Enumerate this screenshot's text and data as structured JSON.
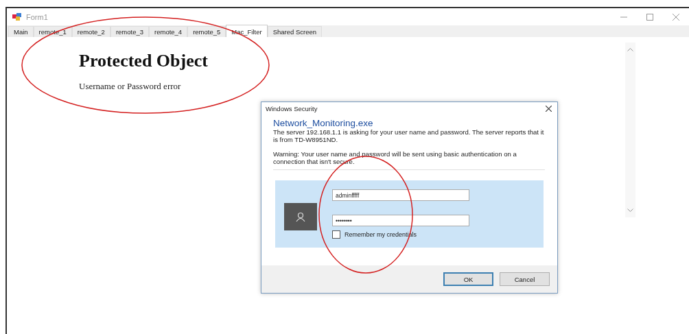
{
  "window": {
    "title": "Form1"
  },
  "tabs": [
    {
      "label": "Main",
      "selected": false
    },
    {
      "label": "remote_1",
      "selected": false
    },
    {
      "label": "remote_2",
      "selected": false
    },
    {
      "label": "remote_3",
      "selected": false
    },
    {
      "label": "remote_4",
      "selected": false
    },
    {
      "label": "remote_5",
      "selected": false
    },
    {
      "label": "Mac_Filter",
      "selected": true
    },
    {
      "label": "Shared Screen",
      "selected": false
    }
  ],
  "page": {
    "heading": "Protected Object",
    "message": "Username or Password error"
  },
  "dialog": {
    "title": "Windows Security",
    "app_name": "Network_Monitoring.exe",
    "description": "The server 192.168.1.1 is asking for your user name and password. The server reports that it is from TD-W8951ND.",
    "warning": "Warning: Your user name and password will be sent using basic authentication on a connection that isn't secure.",
    "username": "adminfffff",
    "password": "••••••••",
    "remember": {
      "label": "Remember my credentials",
      "checked": false
    },
    "buttons": [
      {
        "label": "OK",
        "default": true
      },
      {
        "label": "Cancel",
        "default": false
      }
    ]
  }
}
